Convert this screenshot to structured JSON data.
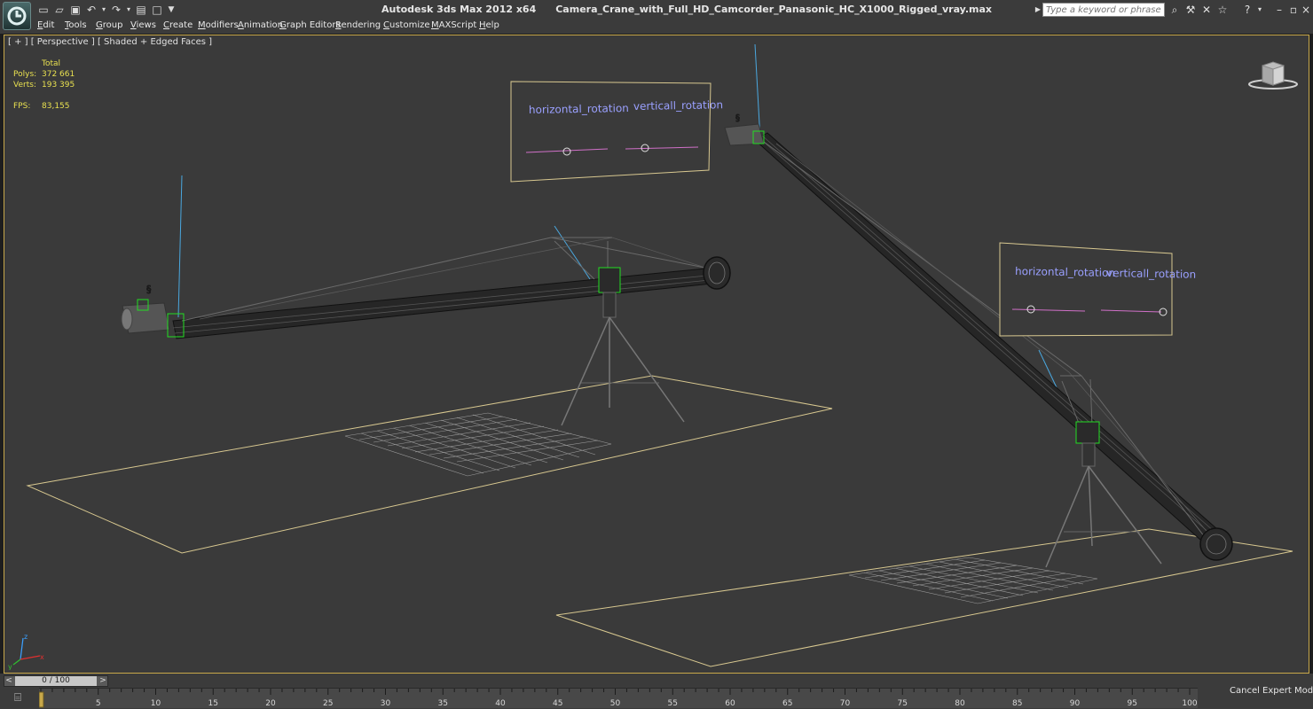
{
  "window": {
    "app_title": "Autodesk 3ds Max  2012 x64",
    "file_title": "Camera_Crane_with_Full_HD_Camcorder_Panasonic_HC_X1000_Rigged_vray.max"
  },
  "search": {
    "placeholder": "Type a keyword or phrase"
  },
  "menu": [
    "Edit",
    "Tools",
    "Group",
    "Views",
    "Create",
    "Modifiers",
    "Animation",
    "Graph Editors",
    "Rendering",
    "Customize",
    "MAXScript",
    "Help"
  ],
  "viewport": {
    "label": "[ + ] [ Perspective ] [ Shaded + Edged Faces ]",
    "stats": {
      "total_label": "Total",
      "polys_label": "Polys:",
      "polys_value": "372 661",
      "verts_label": "Verts:",
      "verts_value": "193 395",
      "fps_label": "FPS:",
      "fps_value": "83,155"
    },
    "panels": [
      {
        "h_label": "horizontal_rotation",
        "v_label": "verticall_rotation"
      },
      {
        "h_label": "horizontal_rotation",
        "v_label": "verticall_rotation"
      }
    ],
    "axes": {
      "x": "x",
      "y": "y",
      "z": "z"
    }
  },
  "timeline": {
    "frame_display": "0 / 100",
    "prev": "<",
    "next": ">",
    "ticks": [
      "5",
      "10",
      "15",
      "20",
      "25",
      "30",
      "35",
      "40",
      "45",
      "50",
      "55",
      "60",
      "65",
      "70",
      "75",
      "80",
      "85",
      "90",
      "95",
      "100"
    ],
    "tick_values": [
      5,
      10,
      15,
      20,
      25,
      30,
      35,
      40,
      45,
      50,
      55,
      60,
      65,
      70,
      75,
      80,
      85,
      90,
      95,
      100
    ],
    "cancel_expert": "Cancel Expert Mode"
  },
  "colors": {
    "selection_border": "#c8a84a",
    "stats_text": "#e8e050",
    "panel_text": "#9aa0ff",
    "slider_track": "#d070c8"
  }
}
